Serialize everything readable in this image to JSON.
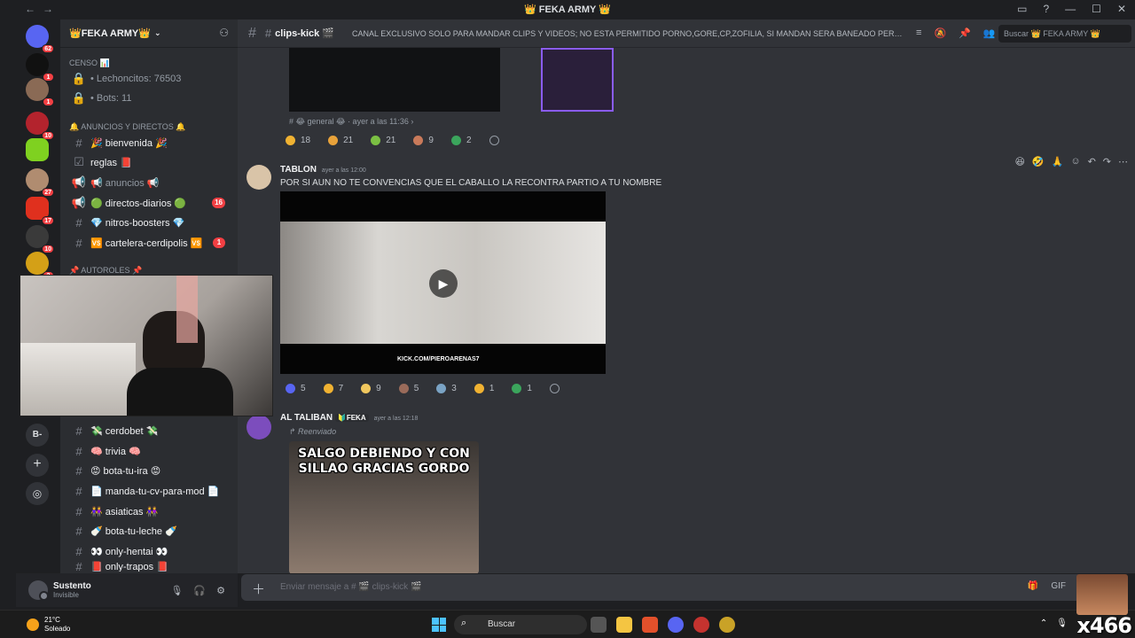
{
  "titlebar": {
    "title": "👑 FEKA ARMY 👑",
    "nav": "←→"
  },
  "rail": {
    "badges": [
      "62",
      "1",
      "1",
      "10",
      "",
      "27",
      "17",
      "10",
      "2"
    ]
  },
  "server": {
    "name": "👑FEKA ARMY👑",
    "chevron": "⌄"
  },
  "sidebar": {
    "censo_category": "CENSO 📊",
    "stats": [
      "• Lechoncitos: 76503",
      "• Bots: 11"
    ],
    "announce_category": "🔔 ANUNCIOS Y DIRECTOS 🔔",
    "channels_top": [
      {
        "name": "🎉 bienvenida 🎉",
        "badge": ""
      },
      {
        "name": "reglas 📕",
        "badge": ""
      },
      {
        "name": "📢 anuncios 📢",
        "badge": ""
      },
      {
        "name": "🟢 directos-diarios 🟢",
        "badge": "16"
      },
      {
        "name": "💎 nitros-boosters 💎",
        "badge": ""
      },
      {
        "name": "🆚 cartelera-cerdipolis 🆚",
        "badge": "1"
      }
    ],
    "autoroles_category": "📌 AUTOROLES 📌",
    "channels_bottom": [
      {
        "name": "💸 cerdobet 💸"
      },
      {
        "name": "🧠 trivia 🧠"
      },
      {
        "name": "😡 bota-tu-ira 😡"
      },
      {
        "name": "📄 manda-tu-cv-para-mod 📄"
      },
      {
        "name": "👭 asiaticas 👭"
      },
      {
        "name": "🍼 bota-tu-leche 🍼"
      },
      {
        "name": "👀 only-hentai 👀"
      },
      {
        "name": "📕 only-trapos 📕"
      }
    ],
    "rail_letters": [
      "B-"
    ]
  },
  "user": {
    "name": "Sustento",
    "status": "Invisible"
  },
  "channel": {
    "name": "clips-kick 🎬",
    "topic": "CANAL EXCLUSIVO SOLO PARA MANDAR CLIPS Y VIDEOS; NO ESTA PERMITIDO PORNO,GORE,CP,ZOFILIA, SI MANDAN SERA BANEADO PERMA...",
    "search_placeholder": "Buscar 👑 FEKA ARMY 👑"
  },
  "messages": {
    "m0": {
      "forward_from": "# 😂 general 😂 · ayer a las 11:36 ›",
      "reactions": [
        {
          "count": "18",
          "color": "#f0b232"
        },
        {
          "count": "21",
          "color": "#e8a23a"
        },
        {
          "count": "21",
          "color": "#7bc043"
        },
        {
          "count": "9",
          "color": "#c97a5a"
        },
        {
          "count": "2",
          "color": "#3ba55c"
        }
      ]
    },
    "m1": {
      "author": "TABLON",
      "time": "ayer a las 12:00",
      "text": "POR SI AUN NO TE CONVENCIAS QUE EL CABALLO LA RECONTRA PARTIO A TU NOMBRE",
      "watermark": "KICK.COM/PIEROARENAS7",
      "reactions": [
        {
          "count": "5",
          "color": "#5865f2"
        },
        {
          "count": "7",
          "color": "#f0b232"
        },
        {
          "count": "9",
          "color": "#f0c75e"
        },
        {
          "count": "5",
          "color": "#9a6b5a"
        },
        {
          "count": "3",
          "color": "#7aa3c4"
        },
        {
          "count": "1",
          "color": "#f0b232"
        },
        {
          "count": "1",
          "color": "#3ba55c"
        }
      ]
    },
    "m2": {
      "author": "AL TALIBAN",
      "tag": "🔰FEKA",
      "time": "ayer a las 12:18",
      "forwarded": "↱ Reenviado",
      "meme_text": "SALGO DEBIENDO Y CON SILLAO GRACIAS GORDO"
    }
  },
  "composer": {
    "placeholder": "Enviar mensaje a # 🎬 clips-kick 🎬"
  },
  "taskbar": {
    "temp": "21°C",
    "weather": "Soleado",
    "search": "Buscar"
  },
  "overlay": {
    "watermark": "x466"
  },
  "colors": {
    "accent": "#5865f2",
    "danger": "#f23f43",
    "bg": "#313338"
  }
}
